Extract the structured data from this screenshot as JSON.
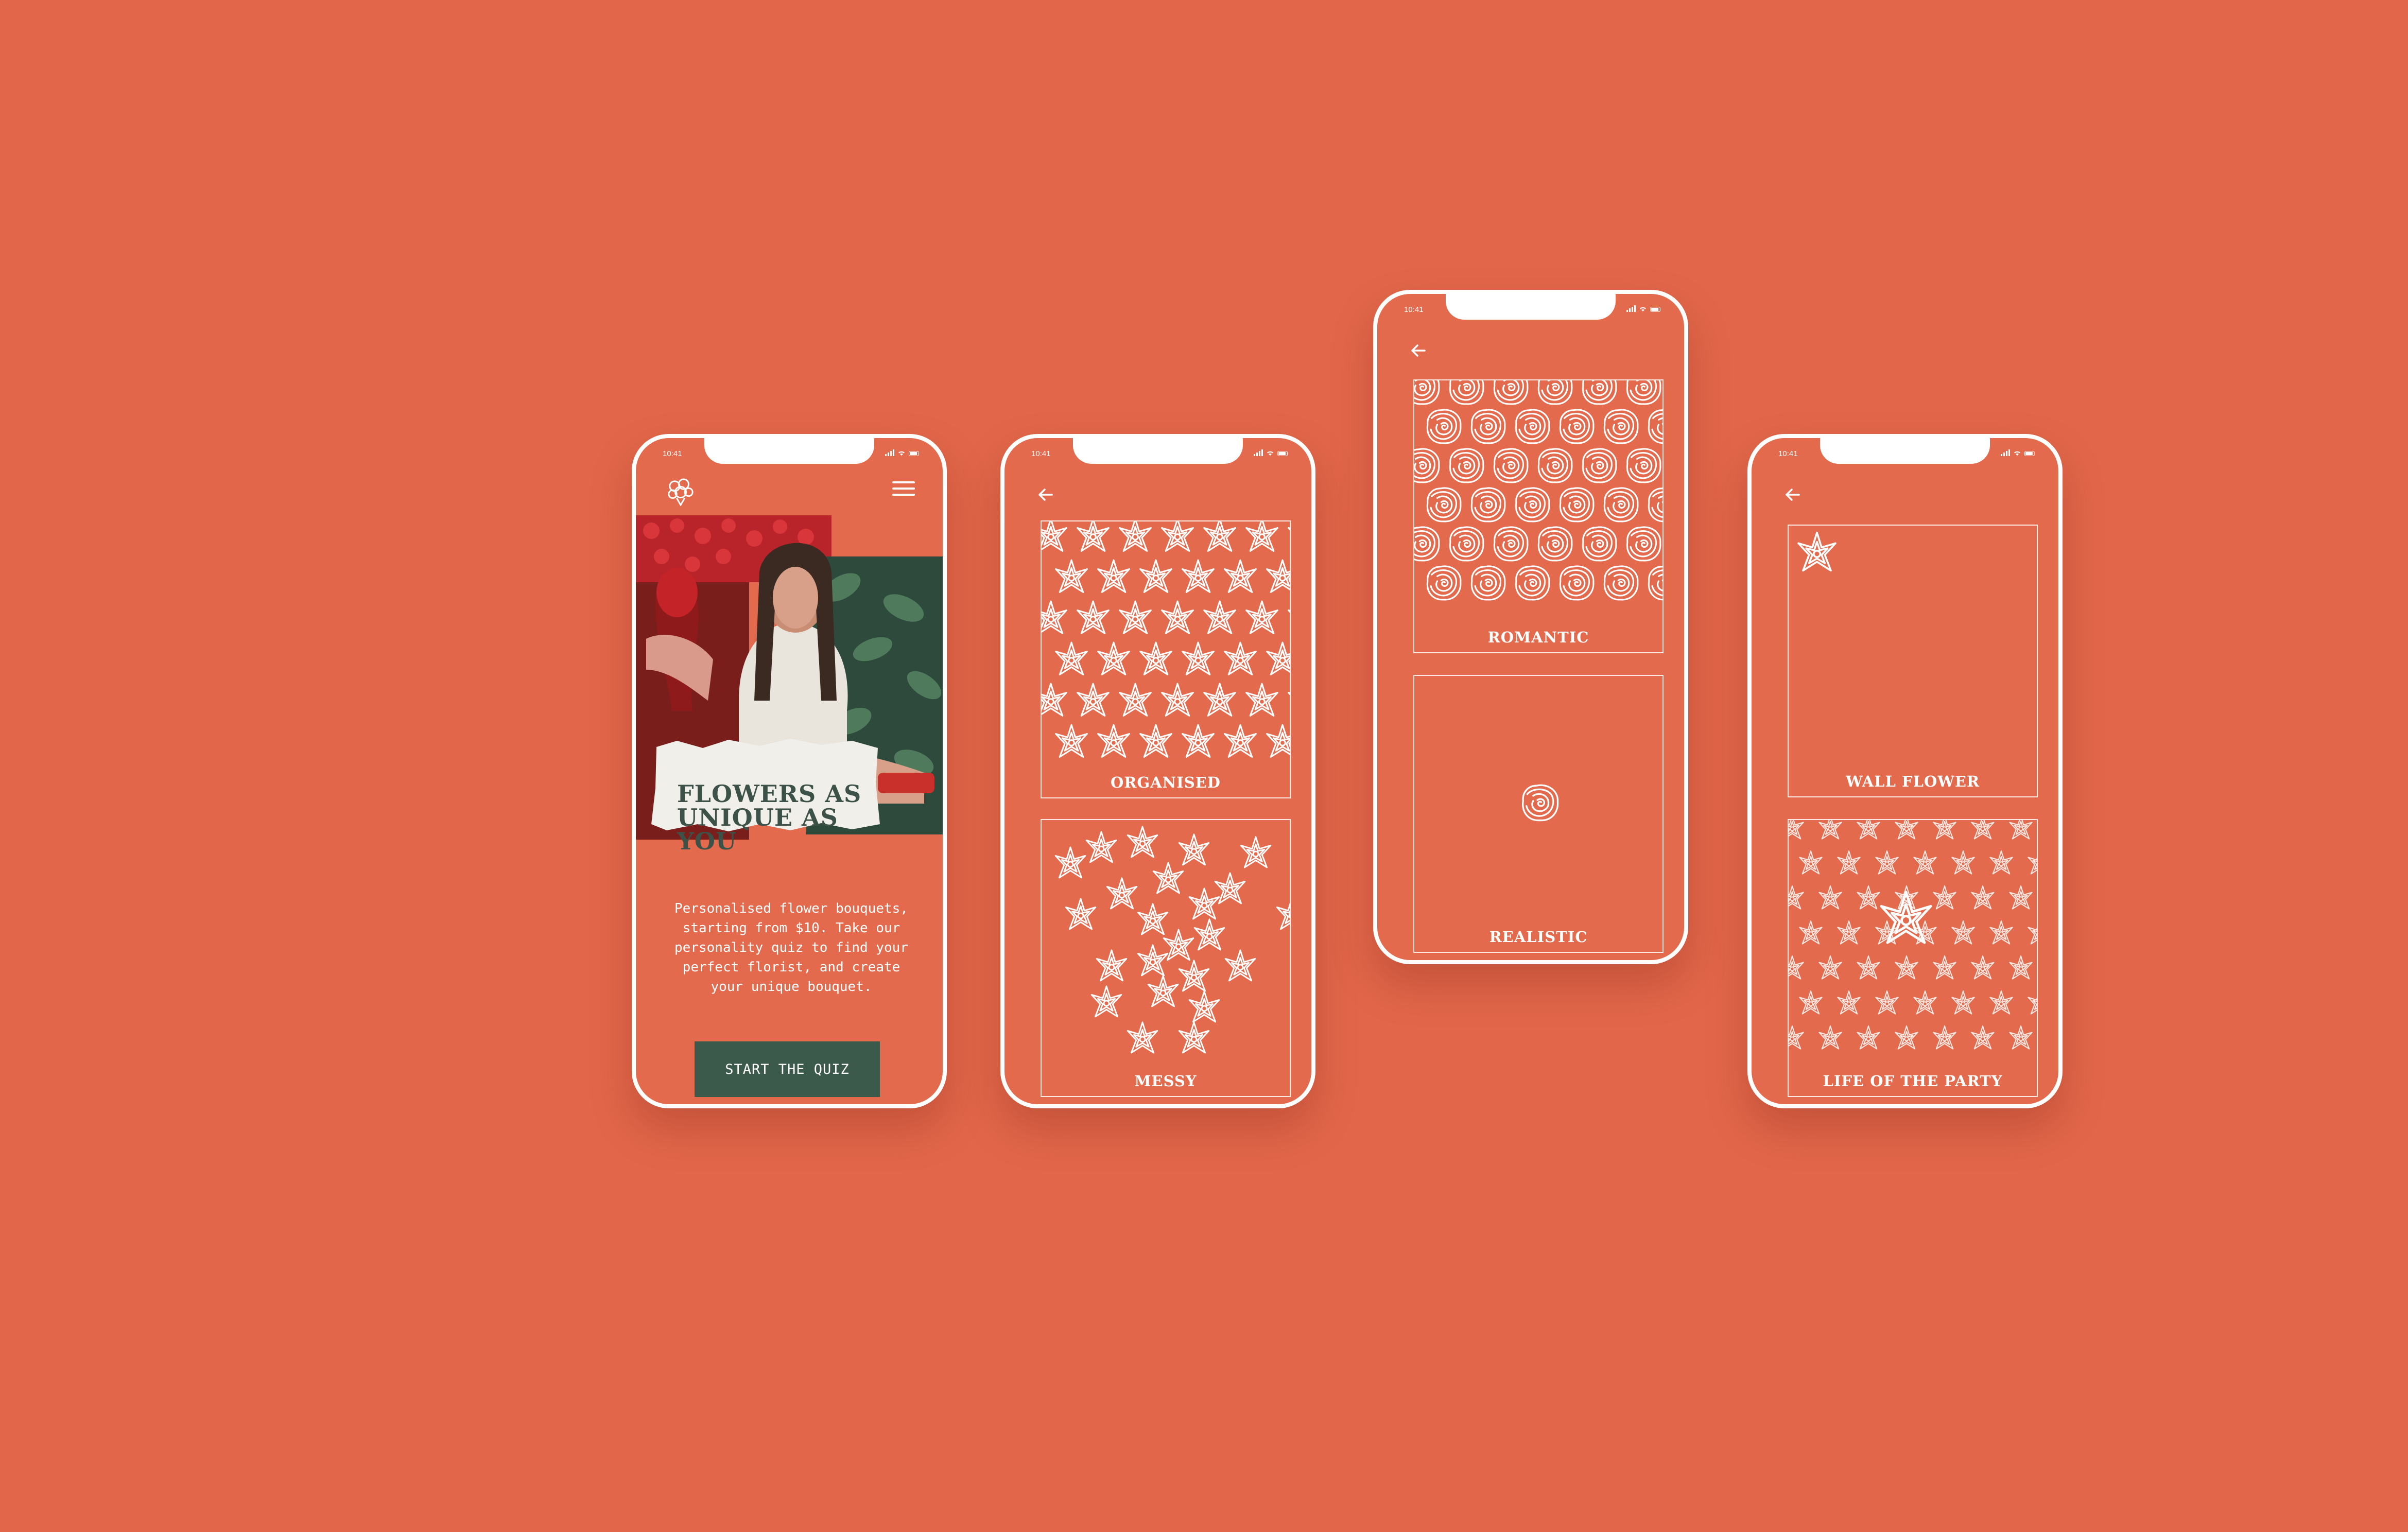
{
  "status_bar": {
    "time": "10:41"
  },
  "screen1": {
    "logo_icon": "bouquet-logo-icon",
    "menu_icon": "hamburger-menu-icon",
    "headline_line1": "FLOWERS AS",
    "headline_line2": "UNIQUE AS YOU",
    "description": "Personalised flower bouquets, starting from $10. Take our personality quiz to find your perfect florist, and create your unique bouquet.",
    "cta_label": "START THE QUIZ"
  },
  "screen2": {
    "back_icon": "back-arrow-icon",
    "options": [
      {
        "label": "ORGANISED",
        "pattern": "grid-star-flowers"
      },
      {
        "label": "MESSY",
        "pattern": "scattered-star-flowers"
      }
    ]
  },
  "screen3": {
    "back_icon": "back-arrow-icon",
    "options": [
      {
        "label": "ROMANTIC",
        "pattern": "rose-grid"
      },
      {
        "label": "REALISTIC",
        "pattern": "single-rose"
      }
    ]
  },
  "screen4": {
    "back_icon": "back-arrow-icon",
    "options": [
      {
        "label": "WALL FLOWER",
        "pattern": "single-small-flower"
      },
      {
        "label": "LIFE OF THE PARTY",
        "pattern": "many-flowers-one-large"
      }
    ]
  },
  "colors": {
    "background": "#e2674a",
    "screen": "#e36a4c",
    "button": "#3c5a4b",
    "headline": "#3c5248",
    "line": "#ffffff"
  }
}
